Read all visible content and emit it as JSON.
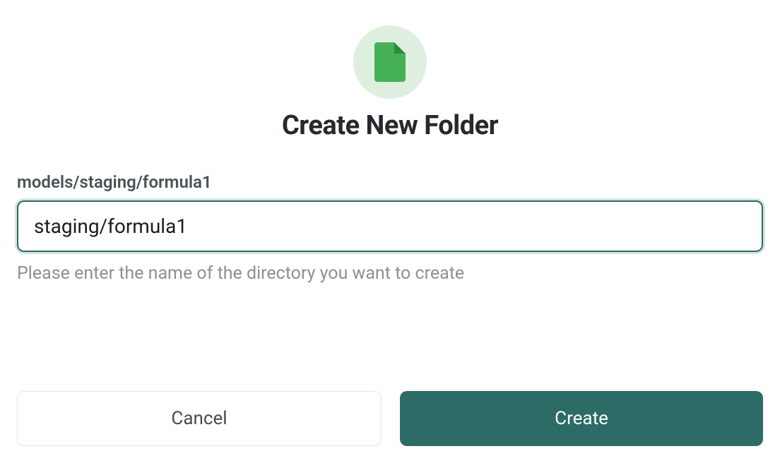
{
  "dialog": {
    "title": "Create New Folder",
    "path_label": "models/staging/formula1",
    "input_value": "staging/formula1",
    "input_placeholder": "",
    "helper_text": "Please enter the name of the directory you want to create",
    "cancel_label": "Cancel",
    "create_label": "Create",
    "icon_name": "file-icon",
    "colors": {
      "accent": "#2d6b67",
      "icon_bg": "#deefdf",
      "icon_fill": "#45b156"
    }
  }
}
